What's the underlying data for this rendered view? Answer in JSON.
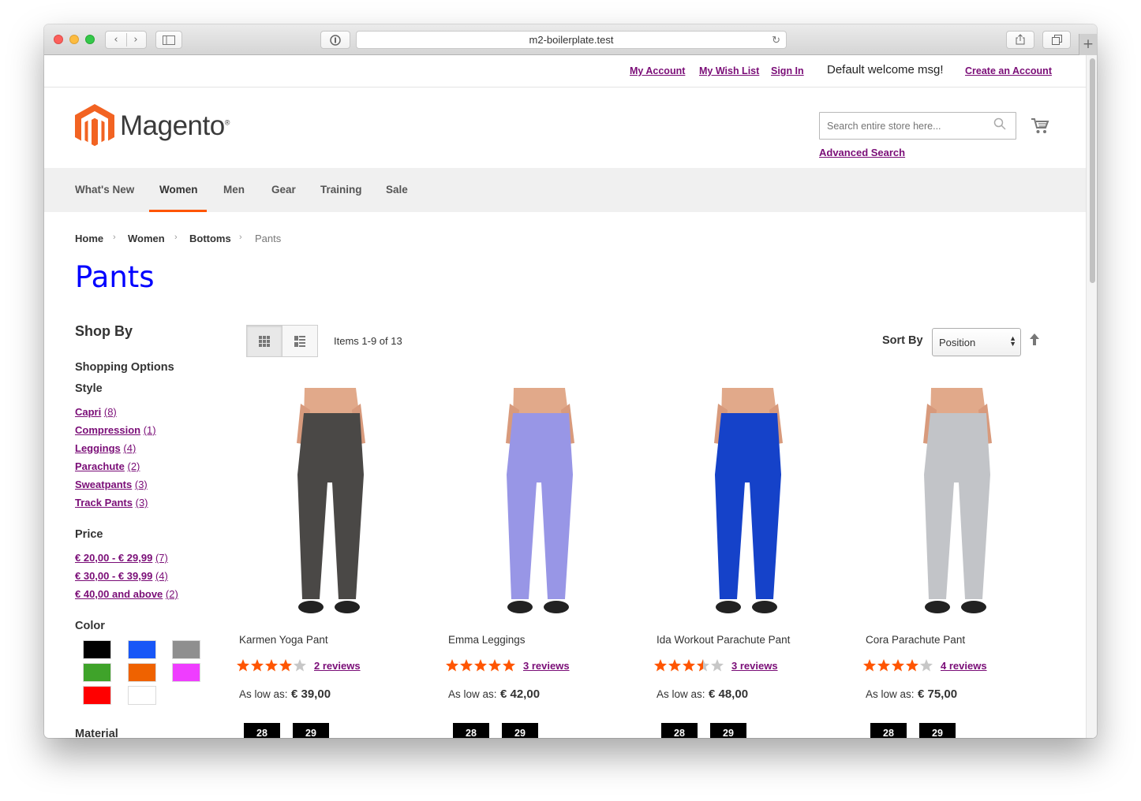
{
  "browser": {
    "url": "m2-boilerplate.test",
    "nav_back": "‹",
    "nav_forward": "›",
    "reload_glyph": "↻",
    "new_tab": "+"
  },
  "header": {
    "links": [
      "My Account",
      "My Wish List",
      "Sign In"
    ],
    "welcome": "Default welcome msg!",
    "create_account": "Create an Account"
  },
  "logo": {
    "text": "Magento",
    "reg": "®",
    "brand_color": "#f26322"
  },
  "search": {
    "placeholder": "Search entire store here...",
    "advanced": "Advanced Search"
  },
  "nav": {
    "items": [
      "What's New",
      "Women",
      "Men",
      "Gear",
      "Training",
      "Sale"
    ],
    "active": "Women",
    "accent": "#ff5501"
  },
  "breadcrumb": [
    "Home",
    "Women",
    "Bottoms",
    "Pants"
  ],
  "page_title": "Pants",
  "sidebar": {
    "shop_by": "Shop By",
    "shopping_options": "Shopping Options",
    "style": {
      "title": "Style",
      "filters": [
        {
          "label": "Capri",
          "count": "(8)"
        },
        {
          "label": "Compression",
          "count": "(1)"
        },
        {
          "label": "Leggings",
          "count": "(4)"
        },
        {
          "label": "Parachute",
          "count": "(2)"
        },
        {
          "label": "Sweatpants",
          "count": "(3)"
        },
        {
          "label": "Track Pants",
          "count": "(3)"
        }
      ]
    },
    "price": {
      "title": "Price",
      "filters": [
        {
          "label": "€ 20,00 - € 29,99",
          "count": "(7)"
        },
        {
          "label": "€ 30,00 - € 39,99",
          "count": "(4)"
        },
        {
          "label": "€ 40,00 and above",
          "count": "(2)"
        }
      ]
    },
    "color": {
      "title": "Color",
      "swatches": [
        "#000000",
        "#1857f7",
        "#8f8f8f",
        "#3fa32a",
        "#ef6200",
        "#ef3dff",
        "#ff0000",
        "#ffffff"
      ]
    },
    "material": {
      "title": "Material"
    }
  },
  "toolbar": {
    "items_count": "Items 1-9 of 13",
    "sort_label": "Sort By",
    "sort_value": "Position",
    "modes": [
      "grid",
      "list"
    ]
  },
  "products": [
    {
      "name": "Karmen Yoga Pant",
      "rating_stars": 4,
      "reviews": "2 reviews",
      "price_label": "As low as:",
      "price": "€ 39,00",
      "sizes": [
        "28",
        "29"
      ],
      "pant_color": "#4a4846"
    },
    {
      "name": "Emma Leggings",
      "rating_stars": 5,
      "reviews": "3 reviews",
      "price_label": "As low as:",
      "price": "€ 42,00",
      "sizes": [
        "28",
        "29"
      ],
      "pant_color": "#9896e6"
    },
    {
      "name": "Ida Workout Parachute Pant",
      "rating_stars": 3.5,
      "reviews": "3 reviews",
      "price_label": "As low as:",
      "price": "€ 48,00",
      "sizes": [
        "28",
        "29"
      ],
      "pant_color": "#1542c9"
    },
    {
      "name": "Cora Parachute Pant",
      "rating_stars": 4,
      "reviews": "4 reviews",
      "price_label": "As low as:",
      "price": "€ 75,00",
      "sizes": [
        "28",
        "29"
      ],
      "pant_color": "#c2c4c8"
    }
  ]
}
